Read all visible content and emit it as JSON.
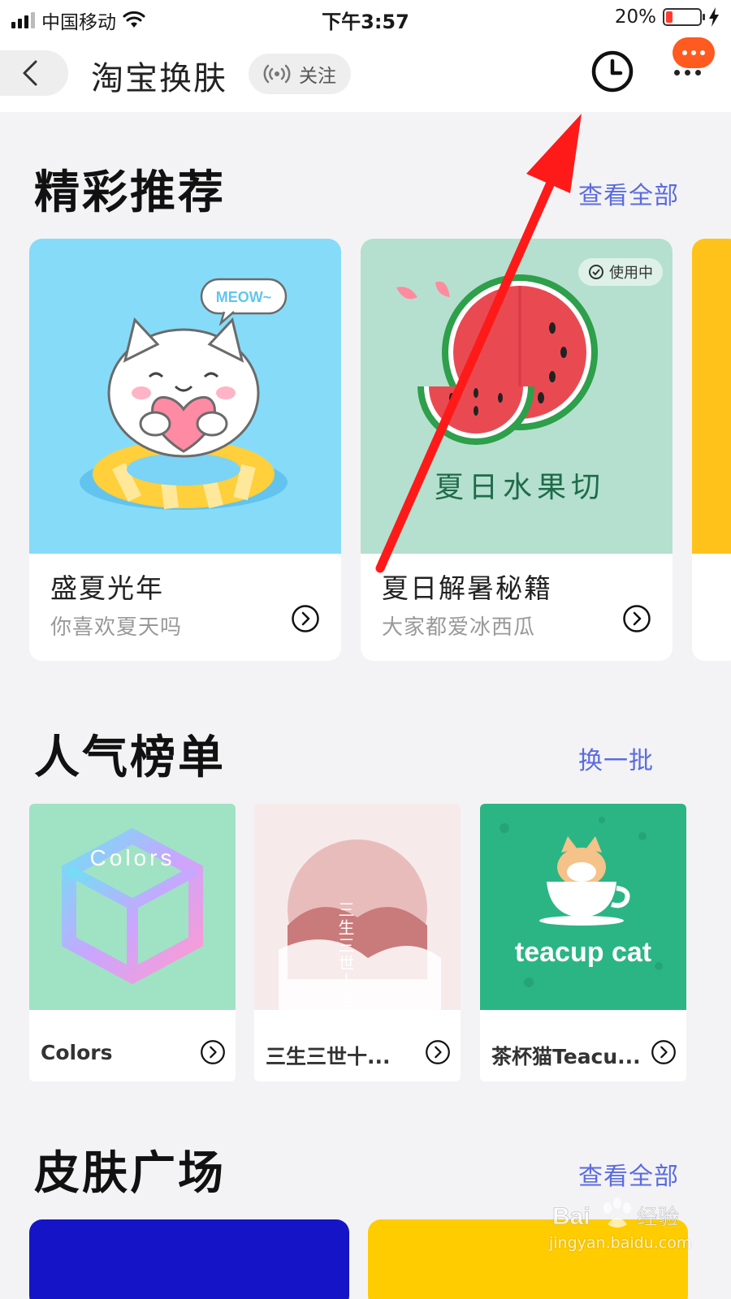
{
  "status_bar": {
    "carrier": "中国移动",
    "time": "下午3:57",
    "battery_percent": "20%",
    "battery_level": 0.2,
    "icons": [
      "signal-icon",
      "wifi-icon",
      "battery-icon",
      "charging-icon"
    ]
  },
  "nav": {
    "title": "淘宝换肤",
    "follow_label": "关注",
    "icons": [
      "back-icon",
      "broadcast-icon",
      "history-clock-icon",
      "message-bubble-icon",
      "more-dots-icon"
    ]
  },
  "featured": {
    "title": "精彩推荐",
    "link": "查看全部",
    "cards": [
      {
        "title": "盛夏光年",
        "subtitle": "你喜欢夏天吗",
        "art_text": "MEOW~",
        "bg": "#86dcf8"
      },
      {
        "title": "夏日解暑秘籍",
        "subtitle": "大家都爱冰西瓜",
        "art_text": "夏日水果切",
        "badge": "使用中",
        "bg": "#b5e0cf"
      }
    ]
  },
  "ranking": {
    "title": "人气榜单",
    "link": "换一批",
    "items": [
      {
        "label": "Colors",
        "art_text": "Colors",
        "bg": "#9fe3c4"
      },
      {
        "label": "三生三世十...",
        "art_text": "三生三世十里桃花",
        "bg": "#f7eaea"
      },
      {
        "label": "茶杯猫Teacu...",
        "art_text": "teacup cat",
        "bg": "#2bb585"
      }
    ]
  },
  "plaza": {
    "title": "皮肤广场",
    "link": "查看全部",
    "card_colors": [
      "#1515c7",
      "#ffcc00"
    ]
  },
  "watermark": {
    "brand": "Baidu经验",
    "url": "jingyan.baidu.com"
  },
  "colors": {
    "accent_link": "#5b6be0",
    "annotation_arrow": "#ff1a1a",
    "msg_badge": "#ff5a1f"
  }
}
